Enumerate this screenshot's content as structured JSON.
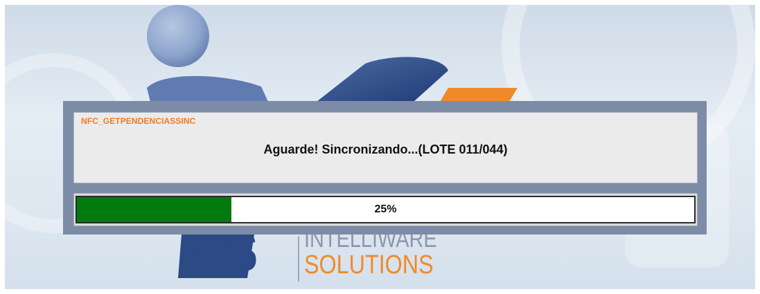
{
  "background": {
    "logo_word": "IWS",
    "logo_line1": "INTELLIWARE",
    "logo_line2": "SOLUTIONS"
  },
  "dialog": {
    "operation_code": "NFC_GETPENDENCIASSINC",
    "message": "Aguarde! Sincronizando...(LOTE 011/044)"
  },
  "progress": {
    "value": 0.25,
    "label": "25%",
    "fill_color": "#027b0e"
  },
  "colors": {
    "accent_orange": "#f07a1e",
    "logo_blue": "#2b4a86",
    "dialog_frame": "#7d8ca6"
  }
}
